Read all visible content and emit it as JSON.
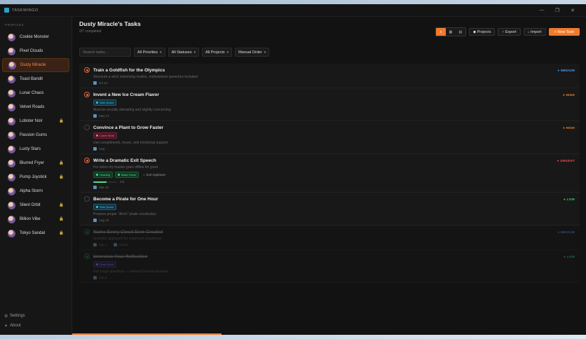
{
  "app": {
    "name": "TASKWINGO"
  },
  "window_controls": {
    "minimize": "—",
    "maximize": "❐",
    "close": "✕"
  },
  "sidebar": {
    "section_label": "PROFILES",
    "profiles": [
      {
        "name": "Cookie Monster",
        "locked": false,
        "active": false
      },
      {
        "name": "Pixel Clouds",
        "locked": false,
        "active": false
      },
      {
        "name": "Dusty Miracle",
        "locked": false,
        "active": true
      },
      {
        "name": "Toast Bandit",
        "locked": false,
        "active": false
      },
      {
        "name": "Lunar Chaos",
        "locked": false,
        "active": false
      },
      {
        "name": "Velvet Roads",
        "locked": false,
        "active": false
      },
      {
        "name": "Lobster Noir",
        "locked": true,
        "active": false
      },
      {
        "name": "Passion Gums",
        "locked": false,
        "active": false
      },
      {
        "name": "Lusty Stars",
        "locked": false,
        "active": false
      },
      {
        "name": "Blurred Fryer",
        "locked": true,
        "active": false
      },
      {
        "name": "Pump Joystick",
        "locked": true,
        "active": false
      },
      {
        "name": "Alpha Storm",
        "locked": false,
        "active": false
      },
      {
        "name": "Silent Orbit",
        "locked": true,
        "active": false
      },
      {
        "name": "Billion Vibe",
        "locked": true,
        "active": false
      },
      {
        "name": "Tokyo Sandal",
        "locked": true,
        "active": false
      }
    ],
    "footer": [
      {
        "label": "Settings",
        "icon": "⚙"
      },
      {
        "label": "About",
        "icon": "✦"
      }
    ]
  },
  "header": {
    "title": "Dusty Miracle's Tasks",
    "subtitle": "2/7 completed",
    "view_icons": [
      "≡",
      "▦",
      "▤"
    ],
    "buttons": {
      "projects": "◆ Projects",
      "export": "↑ Export",
      "import": "↓ Import",
      "new_task": "+ New Task"
    }
  },
  "filters": {
    "search_placeholder": "Search tasks...",
    "priority": "All Priorities",
    "status": "All Statuses",
    "project": "All Projects",
    "order": "Manual Order"
  },
  "tasks": [
    {
      "title": "Train a Goldfish for the Olympics",
      "status": "in-progress",
      "priority": "● MEDIUM",
      "priority_class": "p-medium",
      "desc": "Structure a strict swimming routine, motivational speeches included",
      "tags": [],
      "date": "Jul 14",
      "faded": false
    },
    {
      "title": "Invent a New Ice Cream Flavor",
      "status": "in-progress",
      "priority": "● HIGH",
      "priority_class": "p-high",
      "tags": [
        {
          "label": "Side Quest",
          "cls": "tag-blue"
        }
      ],
      "desc": "Must be socially alienating and slightly concerning",
      "date": "May 17",
      "faded": false
    },
    {
      "title": "Convince a Plant to Grow Faster",
      "status": "todo",
      "priority": "● HIGH",
      "priority_class": "p-high",
      "tags": [
        {
          "label": "Come Work",
          "cls": "tag-red"
        }
      ],
      "desc": "Use compliments, music, and emotional support",
      "date": "Aug",
      "faded": false
    },
    {
      "title": "Write a Dramatic Exit Speech",
      "status": "in-progress",
      "priority": "● URGENT",
      "priority_class": "p-urgent",
      "desc": "For when my toaster goes offline for good",
      "tags": [
        {
          "label": "Heading",
          "cls": "tag-green"
        },
        {
          "label": "Make Hover",
          "cls": "tag-green"
        }
      ],
      "subtag": "☆ Exit Applause",
      "progress": 0.55,
      "progress_text": "2/3",
      "date": "Mar 22",
      "faded": false
    },
    {
      "title": "Become a Pirate for One Hour",
      "status": "todo",
      "priority": "● LOW",
      "priority_class": "p-low",
      "tags": [
        {
          "label": "Side Quest",
          "cls": "tag-blue"
        }
      ],
      "desc": "Practice proper “Arrrrr” pirate vocabulary",
      "date": "Aug 15",
      "faded": false
    },
    {
      "title": "Name Every Cloud Ever Created",
      "status": "done",
      "priority": "● MEDIUM",
      "priority_class": "p-medium",
      "desc": "Scientific approach for maximum cloudiness",
      "tags": [],
      "date": "Mar 1",
      "date2": "4 links",
      "faded": true
    },
    {
      "title": "Interview Your Reflection",
      "status": "done",
      "priority": "● LOW",
      "priority_class": "p-low",
      "tags": [
        {
          "label": "Deep Work",
          "cls": "tag-purple"
        }
      ],
      "desc": "Ask tough questions — demand honest answers",
      "date": "Jan 8",
      "faded": true
    }
  ],
  "bottom_progress": 0.29
}
